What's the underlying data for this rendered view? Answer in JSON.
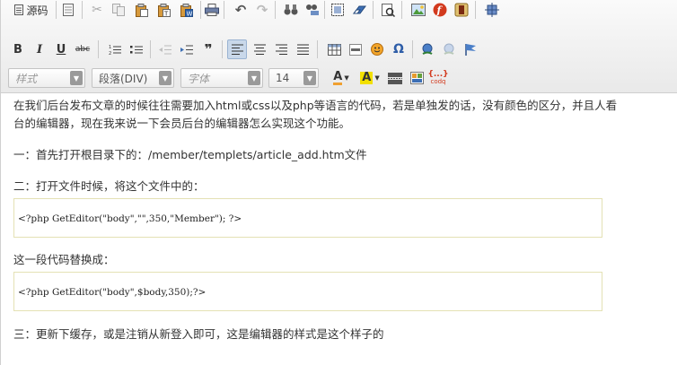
{
  "toolbar": {
    "source_label": "源码",
    "style_select": "样式",
    "paragraph_select": "段落(DIV)",
    "font_select": "字体",
    "size_select": "14",
    "colors": {
      "accent_blue": "#3c6eb4",
      "flash_red": "#d23a1e",
      "highlight_yellow": "#f2e000"
    }
  },
  "content": {
    "intro": "在我们后台发布文章的时候往往需要加入html或css以及php等语言的代码，若是单独发的话，没有颜色的区分，并且人看",
    "intro_cont": "台的编辑器，现在我来说一下会员后台的编辑器怎么实现这个功能。",
    "step1": "一：首先打开根目录下的：/member/templets/article_add.htm文件",
    "step2": "二：打开文件时候，将这个文件中的：",
    "code1": "<?php GetEditor(\"body\",\"\",350,\"Member\"); ?>",
    "replace_line": "这一段代码替换成：",
    "code2": "<?php GetEditor(\"body\",$body,350);?>",
    "step3": "三：更新下缓存，或是注销从新登入即可，这是编辑器的样式是这个样子的"
  }
}
